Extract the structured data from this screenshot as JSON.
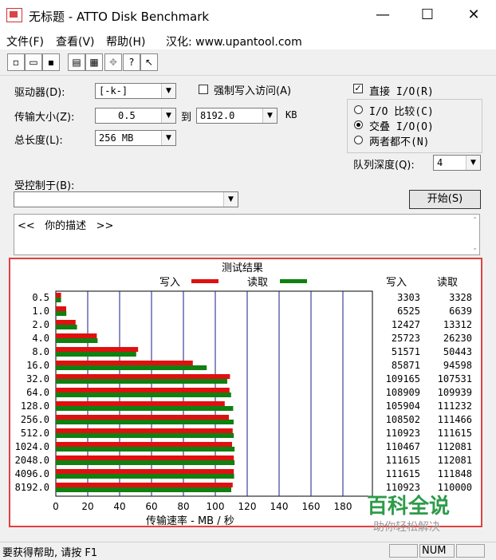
{
  "window": {
    "title": "无标题 - ATTO Disk Benchmark",
    "minimize": "—",
    "maximize": "☐",
    "close": "✕"
  },
  "menu": {
    "file": "文件(F)",
    "view": "查看(V)",
    "help": "帮助(H)",
    "localized": "汉化: www.upantool.com"
  },
  "toolbar": {
    "new": "new-icon",
    "open": "open-icon",
    "save": "save-icon",
    "print": "print-icon",
    "preview": "print-preview-icon",
    "move": "move-icon",
    "help": "help-icon",
    "context_help": "context-help-icon"
  },
  "settings": {
    "drive_label": "驱动器(D):",
    "drive_value": "[-k-]",
    "force_write_label": "强制写入访问(A)",
    "force_write_checked": false,
    "transfer_size_label": "传输大小(Z):",
    "transfer_from": "0.5",
    "to_label": "到",
    "transfer_to": "8192.0",
    "unit": "KB",
    "total_length_label": "总长度(L):",
    "total_length_value": "256 MB",
    "direct_io_label": "直接 I/O(R)",
    "direct_io_checked": true,
    "io_compare_label": "I/O 比较(C)",
    "overlapped_io_label": "交叠 I/O(O)",
    "neither_label": "两者都不(N)",
    "selected_mode": "overlapped_io",
    "queue_depth_label": "队列深度(Q):",
    "queue_depth_value": "4",
    "controlled_by_label": "受控制于(B):",
    "controlled_by_value": "",
    "start_button": "开始(S)",
    "description": "<<   你的描述   >>"
  },
  "results": {
    "title": "测试结果",
    "write_legend": "写入",
    "read_legend": "读取",
    "write_header": "写入",
    "read_header": "读取",
    "colors": {
      "write": "#e01010",
      "read": "#108010",
      "grid": "#1a1a8a"
    },
    "rows": [
      {
        "size": "0.5",
        "write": "3303",
        "read": "3328"
      },
      {
        "size": "1.0",
        "write": "6525",
        "read": "6639"
      },
      {
        "size": "2.0",
        "write": "12427",
        "read": "13312"
      },
      {
        "size": "4.0",
        "write": "25723",
        "read": "26230"
      },
      {
        "size": "8.0",
        "write": "51571",
        "read": "50443"
      },
      {
        "size": "16.0",
        "write": "85871",
        "read": "94598"
      },
      {
        "size": "32.0",
        "write": "109165",
        "read": "107531"
      },
      {
        "size": "64.0",
        "write": "108909",
        "read": "109939"
      },
      {
        "size": "128.0",
        "write": "105904",
        "read": "111232"
      },
      {
        "size": "256.0",
        "write": "108502",
        "read": "111466"
      },
      {
        "size": "512.0",
        "write": "110923",
        "read": "111615"
      },
      {
        "size": "1024.0",
        "write": "110467",
        "read": "112081"
      },
      {
        "size": "2048.0",
        "write": "111615",
        "read": "112081"
      },
      {
        "size": "4096.0",
        "write": "111615",
        "read": "111848"
      },
      {
        "size": "8192.0",
        "write": "110923",
        "read": "110000"
      }
    ],
    "x_ticks": [
      "0",
      "20",
      "40",
      "60",
      "80",
      "100",
      "120",
      "140",
      "160",
      "180"
    ],
    "x_label": "传输速率 - MB / 秒"
  },
  "chart_data": {
    "type": "bar",
    "title": "测试结果",
    "categories": [
      "0.5",
      "1.0",
      "2.0",
      "4.0",
      "8.0",
      "16.0",
      "32.0",
      "64.0",
      "128.0",
      "256.0",
      "512.0",
      "1024.0",
      "2048.0",
      "4096.0",
      "8192.0"
    ],
    "series": [
      {
        "name": "写入",
        "values": [
          3.3,
          6.5,
          12.4,
          25.7,
          51.6,
          85.9,
          109.2,
          108.9,
          105.9,
          108.5,
          110.9,
          110.5,
          111.6,
          111.6,
          110.9
        ]
      },
      {
        "name": "读取",
        "values": [
          3.3,
          6.6,
          13.3,
          26.2,
          50.4,
          94.6,
          107.5,
          109.9,
          111.2,
          111.5,
          111.6,
          112.1,
          112.1,
          111.8,
          110.0
        ]
      }
    ],
    "xlabel": "传输速率 - MB / 秒",
    "xlim": [
      0,
      200
    ],
    "orientation": "horizontal",
    "grid": true
  },
  "status": {
    "help_text": "要获得帮助, 请按 F1",
    "num": "NUM"
  },
  "watermark": {
    "line1": "百科全说",
    "line2": "助你轻松解决"
  }
}
